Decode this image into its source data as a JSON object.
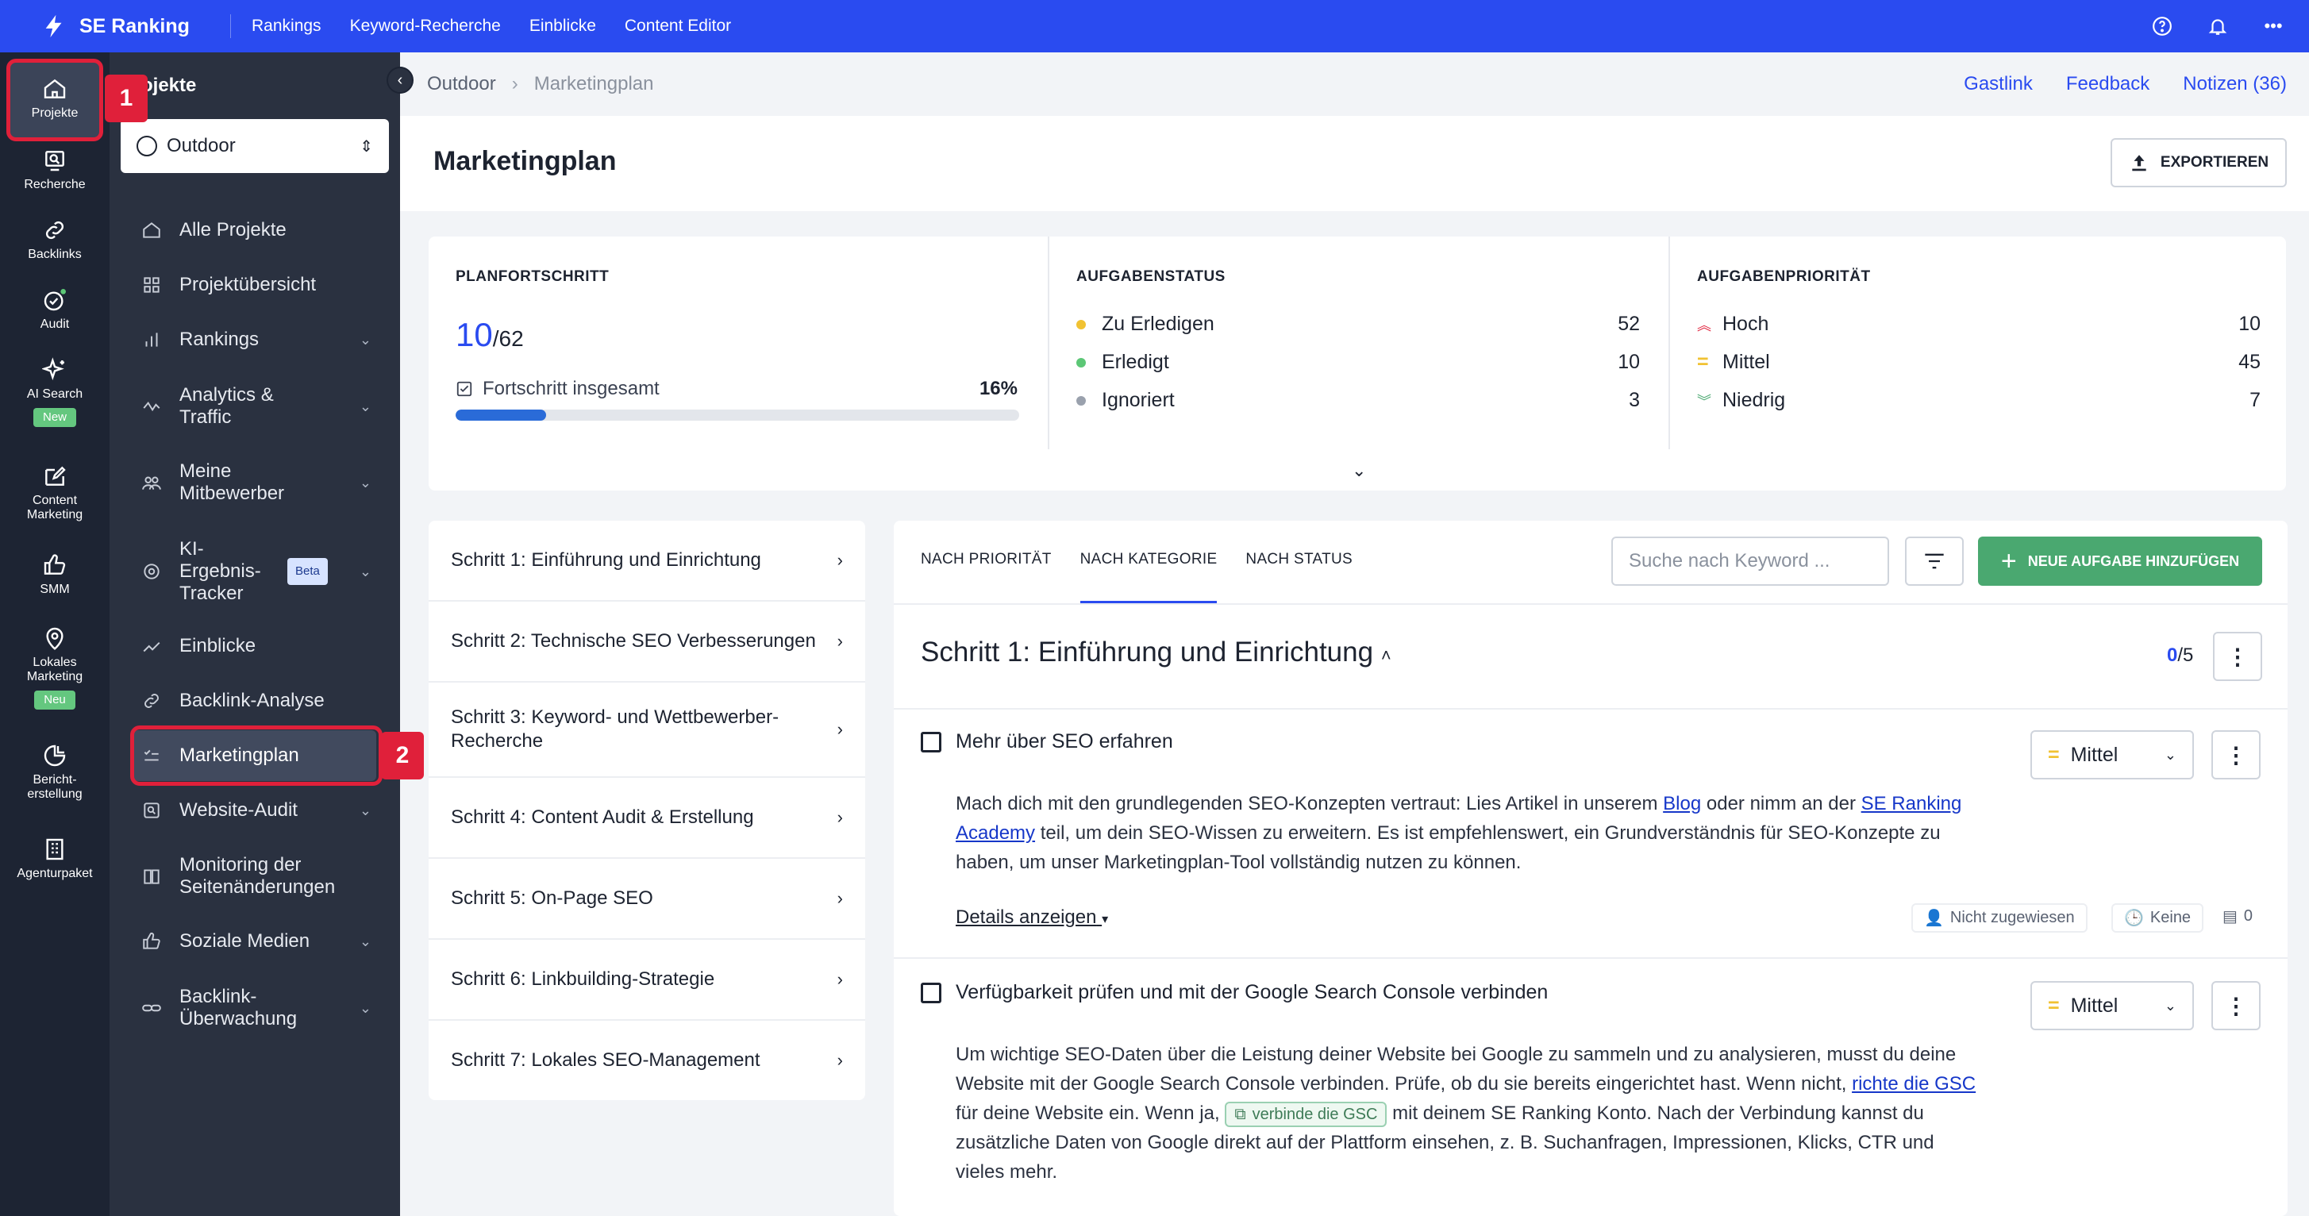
{
  "topbar": {
    "brand": "SE Ranking",
    "nav": [
      "Rankings",
      "Keyword-Recherche",
      "Einblicke",
      "Content Editor"
    ]
  },
  "rail": [
    {
      "label": "Projekte",
      "icon": "home-icon"
    },
    {
      "label": "Recherche",
      "icon": "research-icon"
    },
    {
      "label": "Backlinks",
      "icon": "link-icon"
    },
    {
      "label": "Audit",
      "icon": "audit-icon"
    },
    {
      "label": "AI Search",
      "icon": "sparkle-icon",
      "badge": "New"
    },
    {
      "label": "Content Marketing",
      "icon": "edit-icon"
    },
    {
      "label": "SMM",
      "icon": "thumbs-up-icon"
    },
    {
      "label": "Lokales Marketing",
      "icon": "pin-icon",
      "badge": "Neu"
    },
    {
      "label": "Bericht-erstellung",
      "icon": "report-icon"
    },
    {
      "label": "Agenturpaket",
      "icon": "building-icon"
    }
  ],
  "sidebar": {
    "title": "ojekte",
    "project": "Outdoor",
    "items": [
      {
        "label": "Alle Projekte"
      },
      {
        "label": "Projektübersicht"
      },
      {
        "label": "Rankings"
      },
      {
        "label": "Analytics & Traffic"
      },
      {
        "label": "Meine Mitbewerber"
      },
      {
        "label": "KI-Ergebnis-Tracker",
        "badge": "Beta"
      },
      {
        "label": "Einblicke"
      },
      {
        "label": "Backlink-Analyse"
      },
      {
        "label": "Marketingplan"
      },
      {
        "label": "Website-Audit"
      },
      {
        "label": "Monitoring der Seitenänderungen"
      },
      {
        "label": "Soziale Medien"
      },
      {
        "label": "Backlink-Überwachung"
      }
    ]
  },
  "annotations": [
    "1",
    "2"
  ],
  "breadcrumb": {
    "parent": "Outdoor",
    "current": "Marketingplan"
  },
  "header_links": [
    "Gastlink",
    "Feedback",
    "Notizen (36)"
  ],
  "page": {
    "title": "Marketingplan",
    "export_label": "EXPORTIEREN"
  },
  "progress": {
    "heading": "PLANFORTSCHRITT",
    "done": "10",
    "total": "/62",
    "label": "Fortschritt insgesamt",
    "percent_label": "16%",
    "percent": 16
  },
  "status": {
    "heading": "AUFGABENSTATUS",
    "rows": [
      {
        "label": "Zu Erledigen",
        "value": "52",
        "color": "#f1c232"
      },
      {
        "label": "Erledigt",
        "value": "10",
        "color": "#5cc776"
      },
      {
        "label": "Ignoriert",
        "value": "3",
        "color": "#9aa1ad"
      }
    ]
  },
  "priority": {
    "heading": "AUFGABENPRIORITÄT",
    "rows": [
      {
        "label": "Hoch",
        "value": "10",
        "color": "#e0203a"
      },
      {
        "label": "Mittel",
        "value": "45",
        "color": "#f1c232"
      },
      {
        "label": "Niedrig",
        "value": "7",
        "color": "#4aa870"
      }
    ]
  },
  "steps": [
    "Schritt 1: Einführung und Einrichtung",
    "Schritt 2: Technische SEO Verbesserungen",
    "Schritt 3: Keyword- und Wettbewerber-Recherche",
    "Schritt 4: Content Audit & Erstellung",
    "Schritt 5: On-Page SEO",
    "Schritt 6: Linkbuilding-Strategie",
    "Schritt 7: Lokales SEO-Management"
  ],
  "tabs": [
    "NACH PRIORITÄT",
    "NACH KATEGORIE",
    "NACH STATUS"
  ],
  "search_placeholder": "Suche nach Keyword ...",
  "add_task_label": "NEUE AUFGABE HINZUFÜGEN",
  "section": {
    "title": "Schritt 1: Einführung und Einrichtung",
    "done": "0",
    "total": "/5"
  },
  "tasks": [
    {
      "title": "Mehr über SEO erfahren",
      "priority": "Mittel",
      "desc_a": "Mach dich mit den grundlegenden SEO-Konzepten vertraut: Lies Artikel in unserem ",
      "link_a": "Blog",
      "desc_b": " oder nimm an der ",
      "link_b": "SE Ranking Academy",
      "desc_c": " teil, um dein SEO-Wissen zu erweitern. Es ist empfehlenswert, ein Grundverständnis für SEO-Konzepte zu haben, um unser Marketingplan-Tool vollständig nutzen zu können.",
      "details": "Details anzeigen",
      "assignee": "Nicht zugewiesen",
      "due": "Keine",
      "comments": "0"
    },
    {
      "title": "Verfügbarkeit prüfen und mit der Google Search Console verbinden",
      "priority": "Mittel",
      "desc_a": "Um wichtige SEO-Daten über die Leistung deiner Website bei Google zu sammeln und zu analysieren, musst du deine Website mit der Google Search Console verbinden. Prüfe, ob du sie bereits eingerichtet hast. Wenn nicht, ",
      "link_a": "richte die GSC",
      "desc_b": " für deine Website ein. Wenn ja, ",
      "chip": "verbinde die GSC",
      "desc_c": " mit deinem SE Ranking Konto. Nach der Verbindung kannst du zusätzliche Daten von Google direkt auf der Plattform einsehen, z. B. Suchanfragen, Impressionen, Klicks, CTR und vieles mehr."
    }
  ]
}
